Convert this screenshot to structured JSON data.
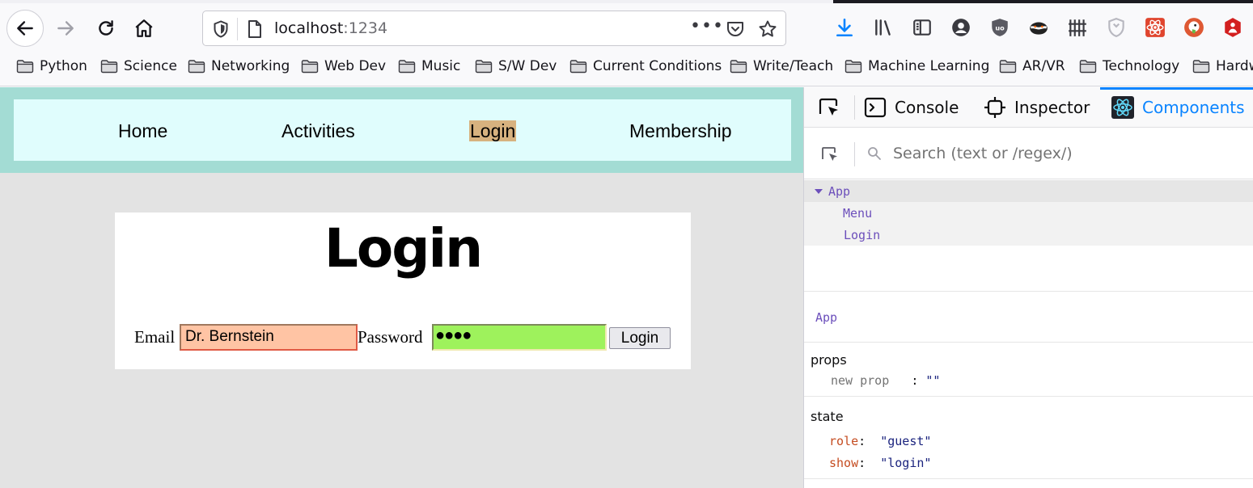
{
  "browser": {
    "url_host": "localhost",
    "url_port": ":1234",
    "url_more": "•••"
  },
  "bookmarks": [
    "Python",
    "Science",
    "Networking",
    "Web Dev",
    "Music",
    "S/W Dev",
    "Current Conditions",
    "Write/Teach",
    "Machine Learning",
    "AR/VR",
    "Technology",
    "Hardw"
  ],
  "app": {
    "menu": {
      "items": [
        "Home",
        "Activities",
        "Login",
        "Membership"
      ],
      "active_index": 2
    },
    "login": {
      "title": "Login",
      "email_label": "Email",
      "email_value": "Dr. Bernstein",
      "password_label": "Password",
      "password_masked": "●●●●",
      "button_label": "Login"
    }
  },
  "devtools": {
    "tabs": {
      "console": "Console",
      "inspector": "Inspector",
      "components": "Components"
    },
    "search_placeholder": "Search (text or /regex/)",
    "tree": {
      "root": "App",
      "children": [
        "Menu",
        "Login"
      ]
    },
    "selected_component": "App",
    "props_title": "props",
    "props": [
      {
        "key": "new prop",
        "value": "\"\""
      }
    ],
    "state_title": "state",
    "state": [
      {
        "key": "role",
        "value": "\"guest\""
      },
      {
        "key": "show",
        "value": "\"login\""
      }
    ]
  },
  "colors": {
    "menu_band": "#a3dcd4",
    "menu_box": "#e0fdfd",
    "menu_active": "#d7b27f",
    "email_bg": "#ffc4a4",
    "password_bg": "#9ef25c",
    "devtools_accent": "#0a84ff"
  }
}
